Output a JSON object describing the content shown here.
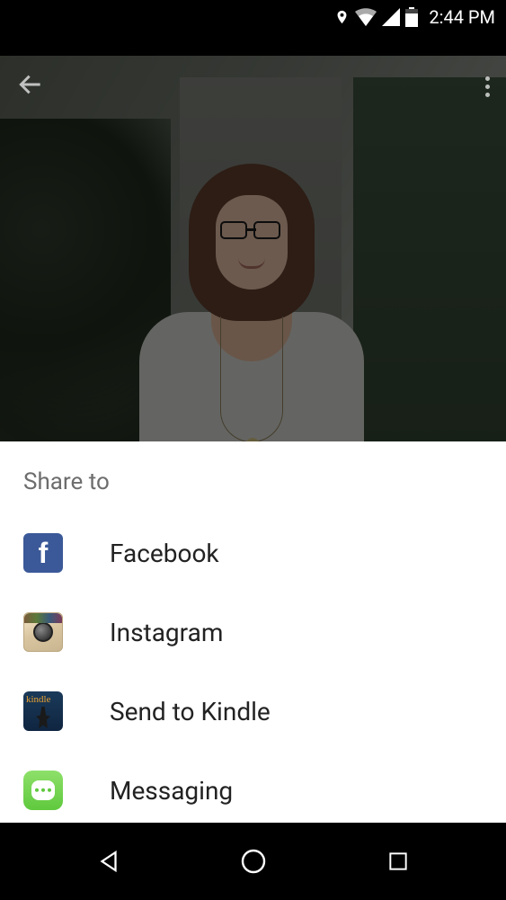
{
  "status": {
    "time": "2:44 PM"
  },
  "share": {
    "title": "Share to",
    "items": [
      {
        "label": "Facebook"
      },
      {
        "label": "Instagram"
      },
      {
        "label": "Send to Kindle"
      },
      {
        "label": "Messaging"
      }
    ]
  }
}
